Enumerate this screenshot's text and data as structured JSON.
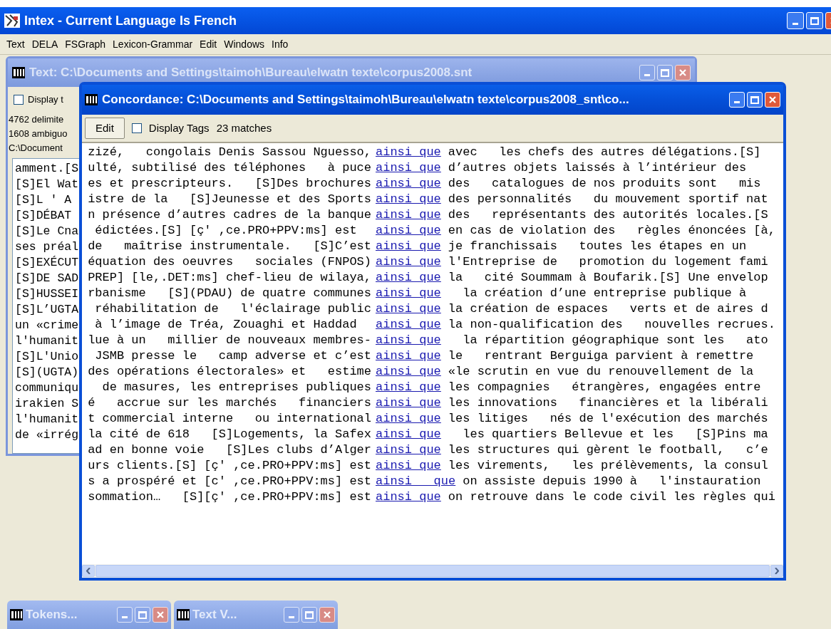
{
  "window": {
    "title": "Intex - Current Language Is French"
  },
  "menu": [
    "Text",
    "DELA",
    "FSGraph",
    "Lexicon-Grammar",
    "Edit",
    "Windows",
    "Info"
  ],
  "text_window": {
    "title": "Text: C:\\Documents and Settings\\taimoh\\Bureau\\elwatn texte\\corpus2008.snt",
    "active": false,
    "display_tags": {
      "label": "Display t",
      "checked": false
    },
    "info_lines": [
      "4762 delimite",
      "1608 ambiguo",
      "C:\\Document"
    ],
    "lines": [
      "amment.[S",
      "[S]El Wat",
      "[S]L ' A",
      "[S]DÉBAT",
      "[S]Le Cna",
      "ses préal",
      "[S]EXÉCUT",
      "[S]DE SAD",
      "[S]HUSSEI",
      "[S]L’UGTA",
      "un «crime",
      "l'humanit",
      "[S]L'Unio",
      "[S](UGTA)",
      "communiqu",
      "irakien S",
      "l'humanit",
      "de «irrég"
    ]
  },
  "concordance_window": {
    "title": "Concordance: C:\\Documents and Settings\\taimoh\\Bureau\\elwatn texte\\corpus2008_snt\\co...",
    "active": true,
    "edit_button": "Edit",
    "display_tags": {
      "label": "Display Tags",
      "checked": false
    },
    "match_count": "23 matches",
    "rows": [
      {
        "left": "zizé,   congolais Denis Sassou Nguesso,",
        "keyword": "ainsi que",
        "right": "avec   les chefs des autres délégations.[S]"
      },
      {
        "left": "ulté, subtilisé des téléphones   à puce",
        "keyword": "ainsi que",
        "right": "d’autres objets laissés à l’intérieur des"
      },
      {
        "left": "es et prescripteurs.   [S]Des brochures",
        "keyword": "ainsi que",
        "right": "des   catalogues de nos produits sont   mis"
      },
      {
        "left": "istre de la   [S]Jeunesse et des Sports",
        "keyword": "ainsi que",
        "right": "des personnalités   du mouvement sportif nat"
      },
      {
        "left": "n présence d’autres cadres de la banque",
        "keyword": "ainsi que",
        "right": "des   représentants des autorités locales.[S"
      },
      {
        "left": " édictées.[S] [ç' ,ce.PRO+PPV:ms] est  ",
        "keyword": "ainsi que",
        "right": "en cas de violation des   règles énoncées [à,"
      },
      {
        "left": "de   maîtrise instrumentale.   [S]C’est",
        "keyword": "ainsi que",
        "right": "je franchissais   toutes les étapes en un"
      },
      {
        "left": "équation des oeuvres   sociales (FNPOS)",
        "keyword": "ainsi que",
        "right": "l'Entreprise de   promotion du logement fami"
      },
      {
        "left": "PREP] [le,.DET:ms] chef-lieu de wilaya,",
        "keyword": "ainsi que",
        "right": "la   cité Soummam à Boufarik.[S] Une envelop"
      },
      {
        "left": "rbanisme   [S](PDAU) de quatre communes",
        "keyword": "ainsi que",
        "right": "  la création d’une entreprise publique à"
      },
      {
        "left": " réhabilitation de   l'éclairage public",
        "keyword": "ainsi que",
        "right": "la création de espaces   verts et de aires d"
      },
      {
        "left": " à l’image de Tréa, Zouaghi et Haddad  ",
        "keyword": "ainsi que",
        "right": "la non-qualification des   nouvelles recrues."
      },
      {
        "left": "lue à un   millier de nouveaux membres-",
        "keyword": "ainsi que",
        "right": "  la répartition géographique sont les   ato"
      },
      {
        "left": " JSMB presse le   camp adverse et c’est",
        "keyword": "ainsi que",
        "right": "le   rentrant Berguiga parvient à remettre"
      },
      {
        "left": "des opérations électorales» et   estime",
        "keyword": "ainsi que",
        "right": "«le scrutin en vue du renouvellement de la"
      },
      {
        "left": "  de masures, les entreprises publiques",
        "keyword": "ainsi que",
        "right": "les compagnies   étrangères, engagées entre"
      },
      {
        "left": "é   accrue sur les marchés   financiers",
        "keyword": "ainsi que",
        "right": "les innovations   financières et la libérali"
      },
      {
        "left": "t commercial interne   ou international",
        "keyword": "ainsi que",
        "right": "les litiges   nés de l'exécution des marchés"
      },
      {
        "left": "la cité de 618   [S]Logements, la Safex",
        "keyword": "ainsi que",
        "right": "  les quartiers Bellevue et les   [S]Pins ma"
      },
      {
        "left": "ad en bonne voie   [S]Les clubs d’Alger",
        "keyword": "ainsi que",
        "right": "les structures qui gèrent le football,   c’e"
      },
      {
        "left": "urs clients.[S] [ç' ,ce.PRO+PPV:ms] est",
        "keyword": "ainsi que",
        "right": "les virements,   les prélèvements, la consul"
      },
      {
        "left": "s a prospéré et [c' ,ce.PRO+PPV:ms] est",
        "keyword": "ainsi   que",
        "right": "on assiste depuis 1990 à   l'instauration"
      },
      {
        "left": "sommation…   [S][ç' ,ce.PRO+PPV:ms] est",
        "keyword": "ainsi que",
        "right": "on retrouve dans le code civil les règles qui"
      }
    ]
  },
  "minimized_windows": [
    {
      "title": "Tokens..."
    },
    {
      "title": "Text V..."
    }
  ]
}
